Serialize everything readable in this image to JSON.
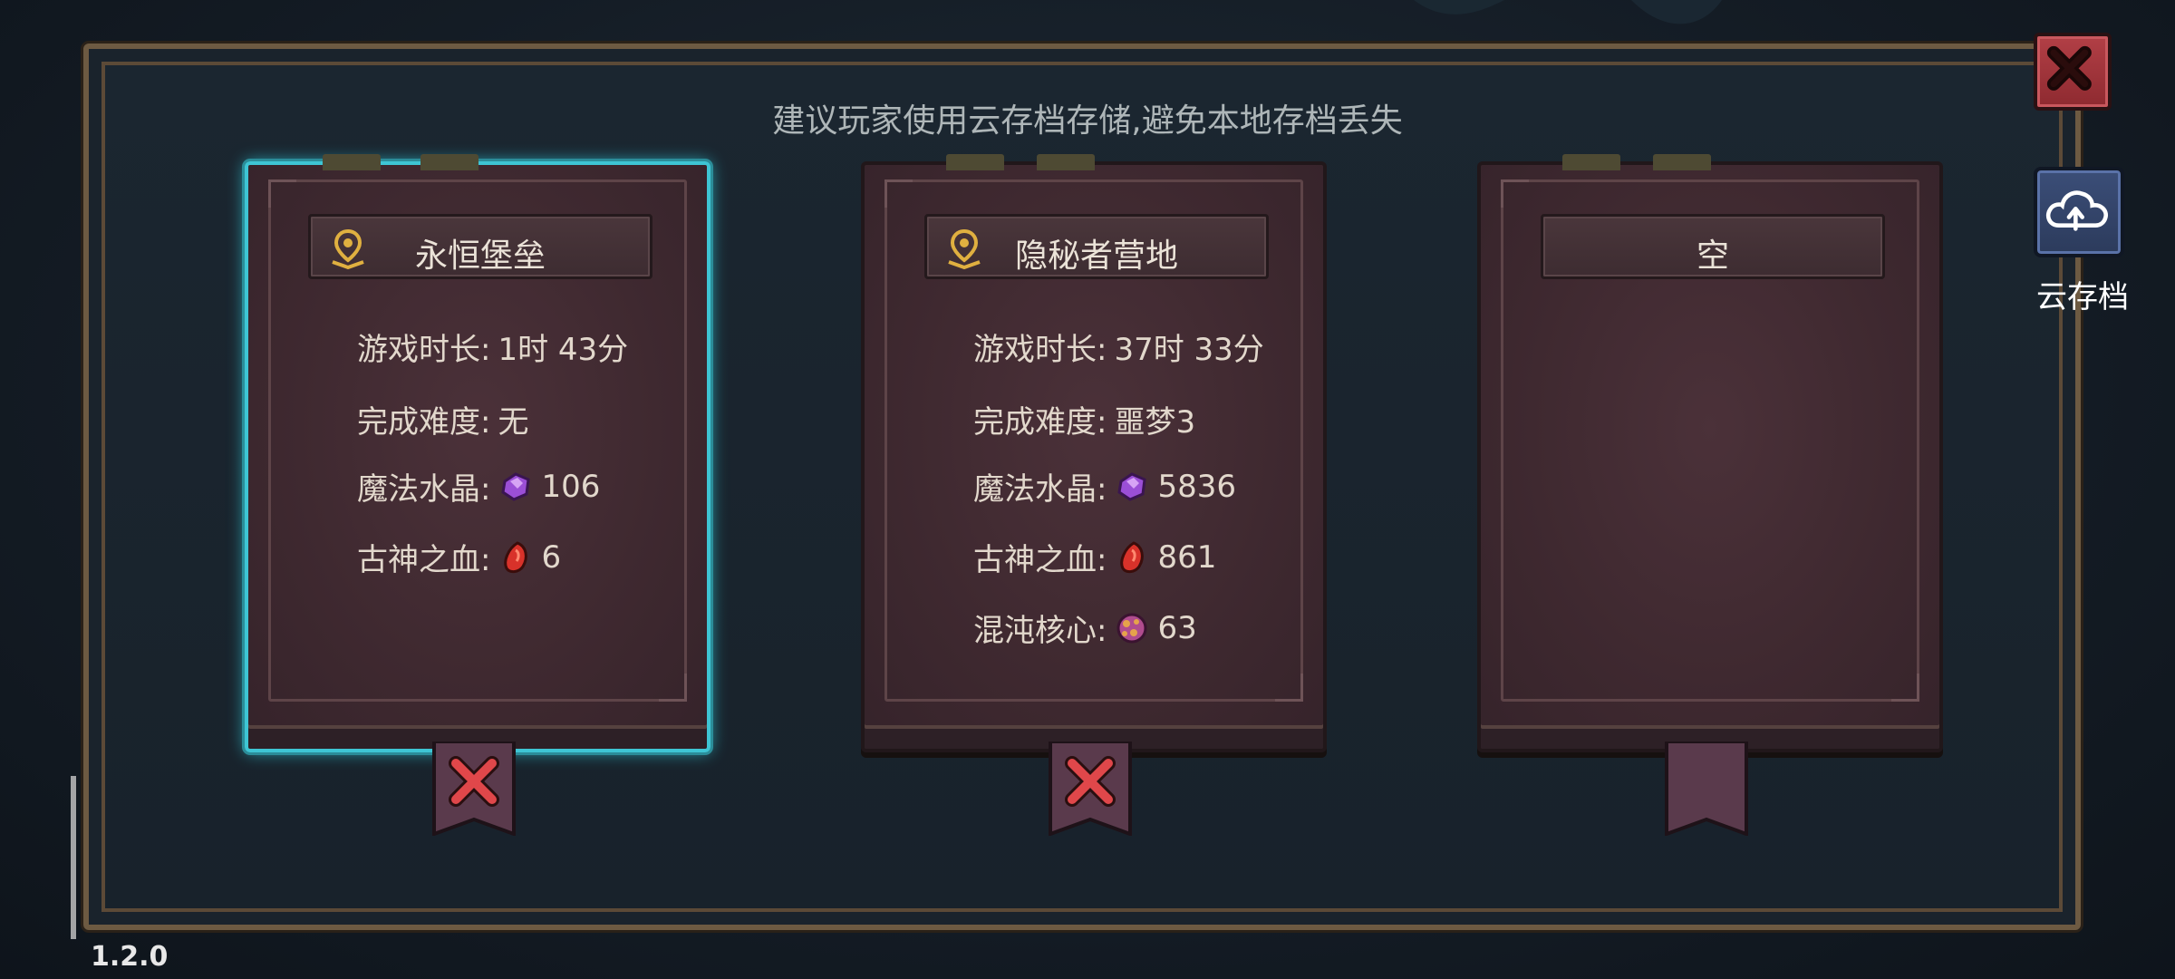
{
  "notice": "建议玩家使用云存档存储,避免本地存档丢失",
  "slots": [
    {
      "title": "永恒堡垒",
      "has_pin": true,
      "selected": true,
      "play_time_label": "游戏时长:",
      "play_time_value": "1时 43分",
      "difficulty_label": "完成难度:",
      "difficulty_value": "无",
      "crystal_label": "魔法水晶:",
      "crystal_value": "106",
      "blood_label": "古神之血:",
      "blood_value": "6",
      "deletable": true
    },
    {
      "title": "隐秘者营地",
      "has_pin": true,
      "selected": false,
      "play_time_label": "游戏时长:",
      "play_time_value": "37时 33分",
      "difficulty_label": "完成难度:",
      "difficulty_value": "噩梦3",
      "crystal_label": "魔法水晶:",
      "crystal_value": "5836",
      "blood_label": "古神之血:",
      "blood_value": "861",
      "chaos_label": "混沌核心:",
      "chaos_value": "63",
      "deletable": true
    },
    {
      "title": "空",
      "has_pin": false,
      "selected": false,
      "deletable": false
    }
  ],
  "cloud_save_label": "云存档",
  "version": "1.2.0",
  "icons": {
    "close": "close-icon",
    "cloud": "cloud-upload-icon",
    "pin": "map-pin-icon",
    "crystal": "purple-crystal-icon",
    "blood": "red-blood-icon",
    "chaos": "chaos-core-icon",
    "delete": "delete-x-icon"
  },
  "colors": {
    "selected_glow": "#3ec5d4",
    "close_red": "#b23f46",
    "cloud_blue": "#3b4e78",
    "pin_gold": "#e0b040"
  }
}
